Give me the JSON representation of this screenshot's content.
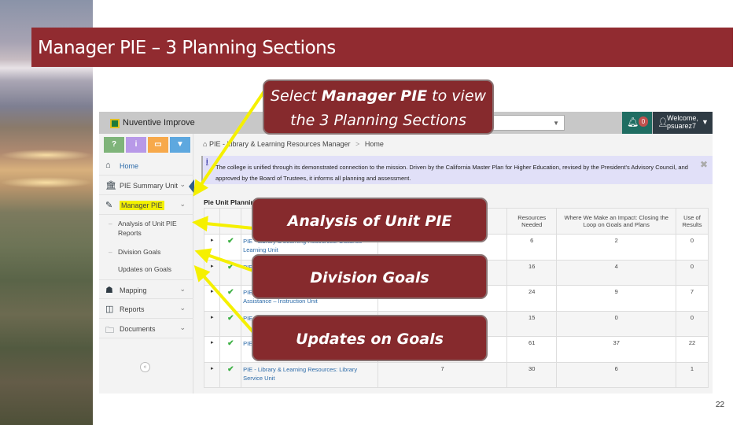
{
  "slide": {
    "title": "Manager PIE – 3 Planning Sections",
    "page_number": "22"
  },
  "callouts": {
    "main_prefix": "Select ",
    "main_bold": "Manager PIE",
    "main_suffix": " to view the 3 Planning Sections",
    "analysis": "Analysis of Unit PIE Reports",
    "division": "Division Goals",
    "updates": "Updates on Goals"
  },
  "app": {
    "brand": "Nuventive Improve",
    "notifications_count": "0",
    "user_label": "Welcome, psuarez7",
    "quick_buttons": [
      {
        "icon": "help-icon",
        "glyph": "?",
        "color": "#7fb47a"
      },
      {
        "icon": "info-icon",
        "glyph": "i",
        "color": "#b899e8"
      },
      {
        "icon": "list-icon",
        "glyph": "▭",
        "color": "#f7a94b"
      },
      {
        "icon": "filter-icon",
        "glyph": "▼",
        "color": "#5ea8df"
      }
    ],
    "sidebar": {
      "items": [
        {
          "label": "Home",
          "icon": "home-icon"
        },
        {
          "label": "PIE Summary Unit",
          "icon": "institution-icon"
        },
        {
          "label": "Manager PIE",
          "icon": "pencil-icon"
        },
        {
          "label": "Mapping",
          "icon": "sitemap-icon"
        },
        {
          "label": "Reports",
          "icon": "columns-icon"
        },
        {
          "label": "Documents",
          "icon": "folder-icon"
        }
      ],
      "subitems": [
        {
          "label": "Analysis of Unit PIE Reports"
        },
        {
          "label": "Division Goals"
        },
        {
          "label": "Updates on Goals"
        }
      ]
    },
    "breadcrumb": {
      "section": "PIE - Library & Learning Resources Manager",
      "separator": ">",
      "page": "Home"
    },
    "info_message": "The college is unified through its demonstrated connection to the mission. Driven by the California Master Plan for Higher Education, revised by the President's Advisory Council, and approved by the Board of Trustees, it informs all planning and assessment.",
    "table": {
      "title": "Pie Unit Planning",
      "columns": [
        "",
        "",
        "",
        "",
        "Resources Needed",
        "Where We Make an Impact: Closing the Loop on Goals and Plans",
        "Use of Results"
      ],
      "rows": [
        {
          "unit": "PIE - Library & Learning Resources: Distance Learning Unit",
          "col4": "",
          "resources": "6",
          "impact": "2",
          "use": "0"
        },
        {
          "unit": "PIE - Library & Learning Resources",
          "col4": "",
          "resources": "16",
          "impact": "4",
          "use": "0"
        },
        {
          "unit": "PIE - Library & Learning Resources: Learning Assistance – Instruction Unit",
          "col4": "",
          "resources": "24",
          "impact": "9",
          "use": "7"
        },
        {
          "unit": "PIE - Library & Learning Resources",
          "col4": "",
          "resources": "15",
          "impact": "0",
          "use": "0"
        },
        {
          "unit": "PIE - Library & Learning Resources: Instruction",
          "col4": "",
          "resources": "61",
          "impact": "37",
          "use": "22"
        },
        {
          "unit": "PIE - Library & Learning Resources: Library Service Unit",
          "col4": "7",
          "resources": "30",
          "impact": "6",
          "use": "1"
        }
      ]
    }
  },
  "colors": {
    "title_bar": "#912b30",
    "callout": "#862a2d",
    "arrow": "#f5f000",
    "highlight": "#f2f000",
    "notify": "#1f6d62",
    "user": "#2f3b44",
    "check": "#3cb043",
    "link": "#2b6aa8"
  }
}
